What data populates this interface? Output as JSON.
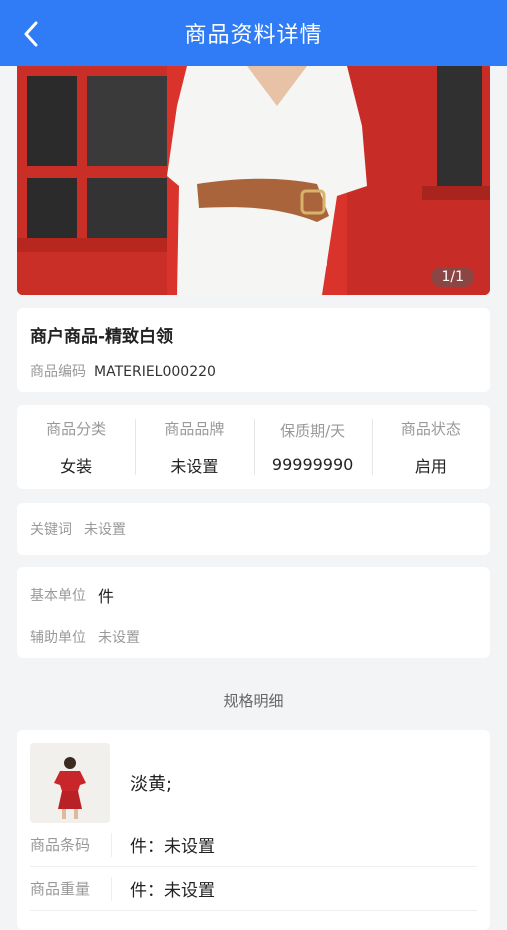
{
  "header": {
    "title": "商品资料详情",
    "back_icon": "chevron-left-icon"
  },
  "hero": {
    "counter": "1/1"
  },
  "product": {
    "name": "商户商品-精致白领",
    "code_label": "商品编码",
    "code_value": "MATERIEL000220"
  },
  "stats": [
    {
      "label": "商品分类",
      "value": "女装"
    },
    {
      "label": "商品品牌",
      "value": "未设置"
    },
    {
      "label": "保质期/天",
      "value": "99999990"
    },
    {
      "label": "商品状态",
      "value": "启用"
    }
  ],
  "keywords": {
    "label": "关键词",
    "value": "未设置"
  },
  "units": {
    "base_label": "基本单位",
    "base_value": "件",
    "aux_label": "辅助单位",
    "aux_value": "未设置"
  },
  "spec_section": {
    "title": "规格明细"
  },
  "spec": {
    "color": "淡黄;",
    "rows": [
      {
        "label": "商品条码",
        "value": "件：未设置"
      },
      {
        "label": "商品重量",
        "value": "件：未设置"
      }
    ]
  },
  "colors": {
    "accent": "#2f7cf6"
  }
}
